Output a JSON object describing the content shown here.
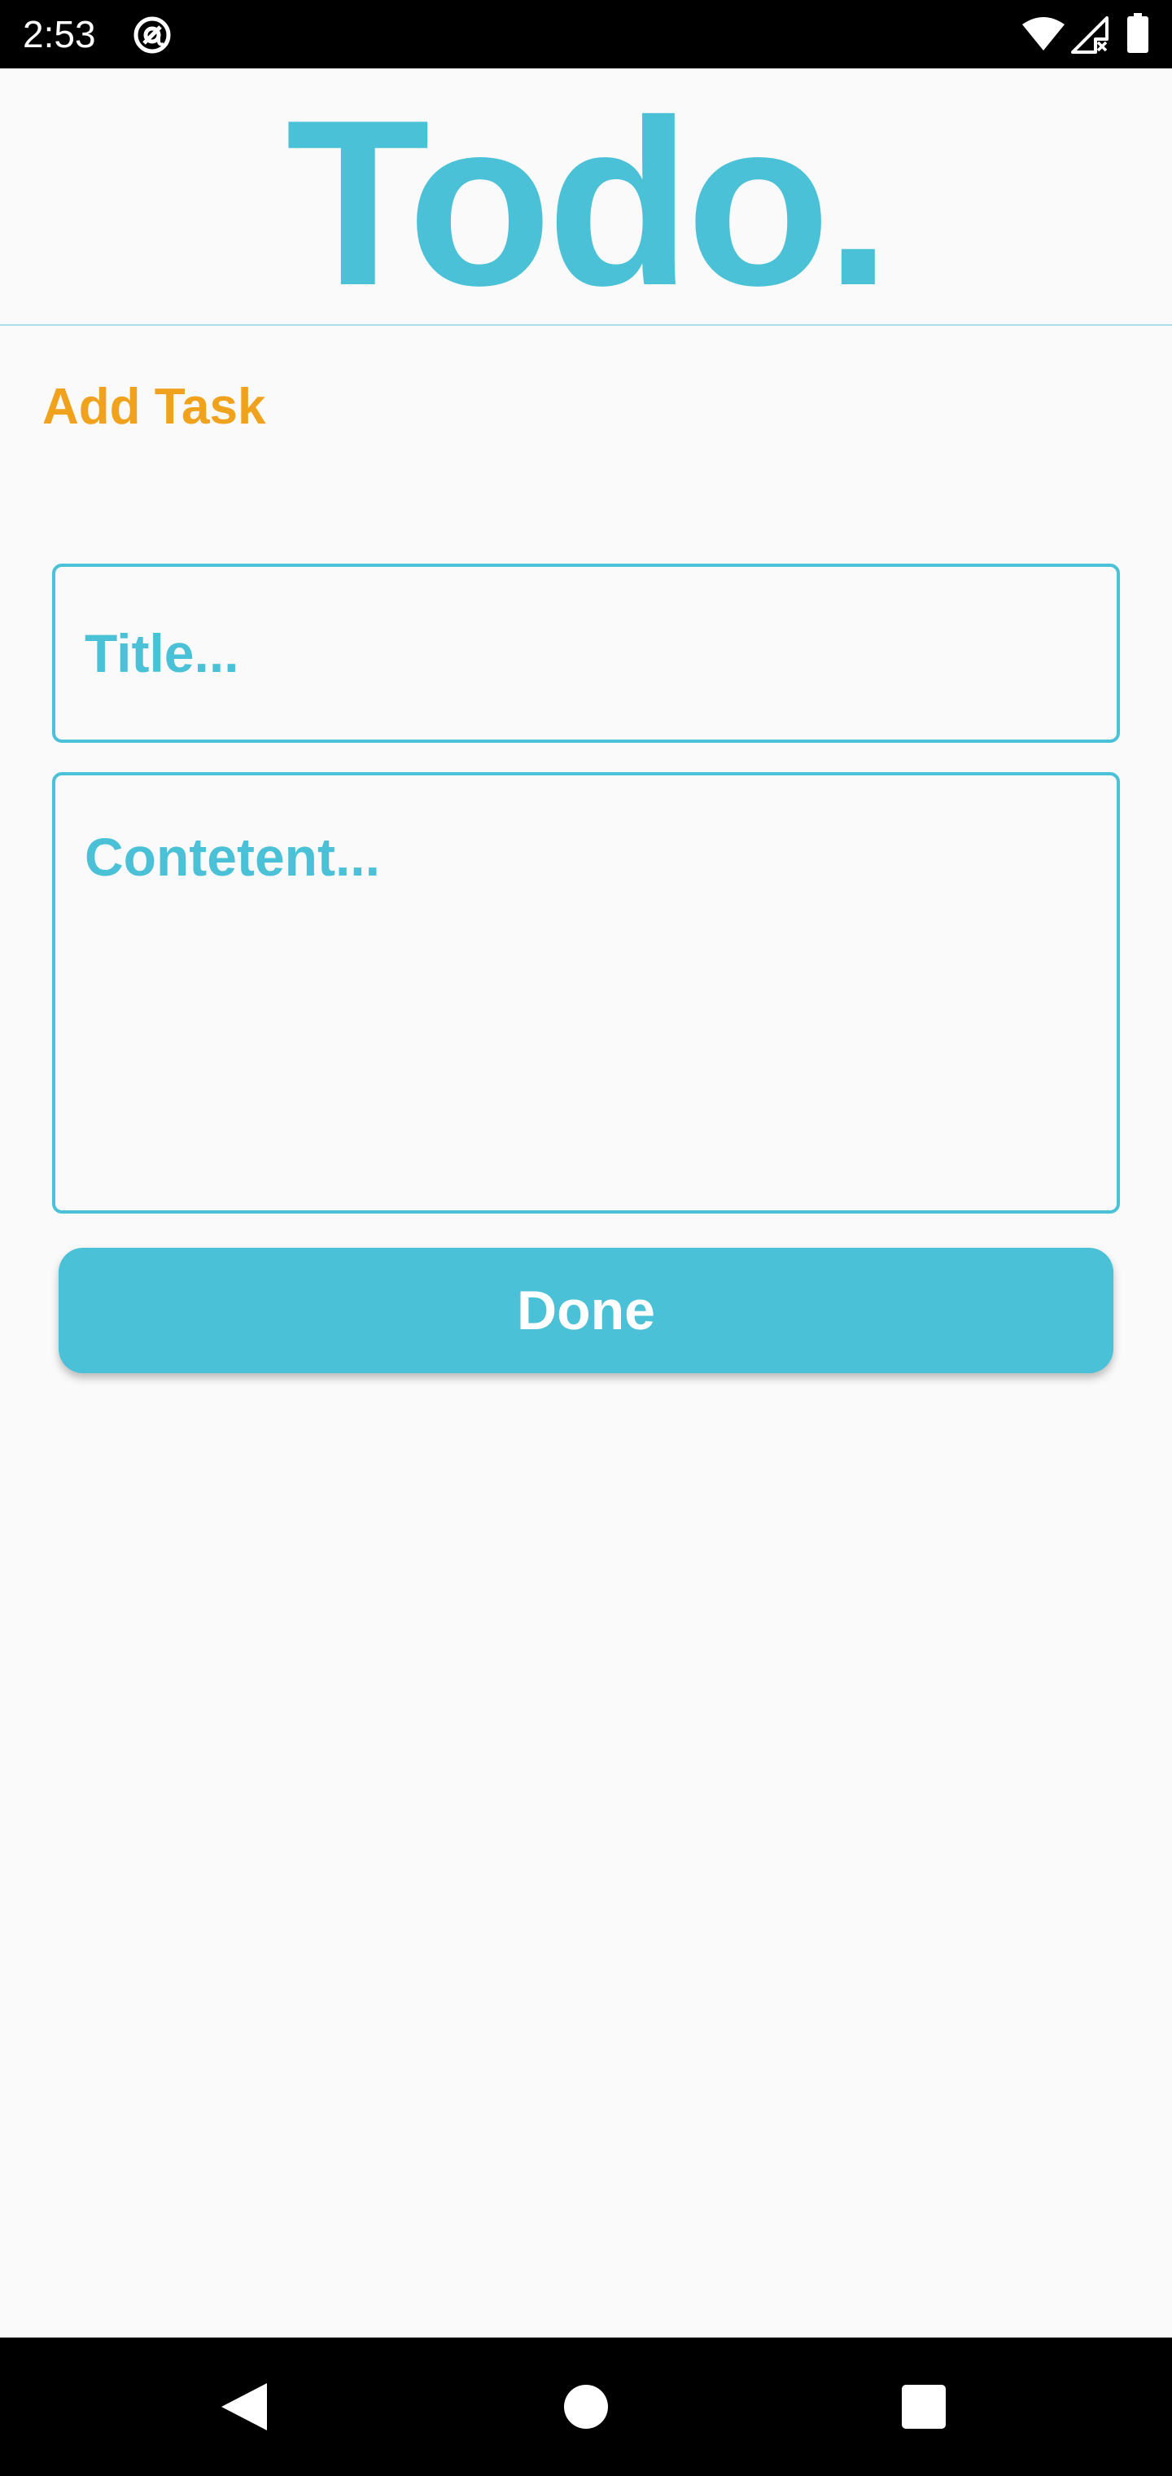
{
  "status_bar": {
    "time": "2:53",
    "app_icon": "at-sign-icon",
    "wifi_icon": "wifi-icon",
    "signal_icon": "cell-signal-no-service-icon",
    "battery_icon": "battery-icon"
  },
  "header": {
    "title": "Todo."
  },
  "section": {
    "heading": "Add Task"
  },
  "form": {
    "title_value": "",
    "title_placeholder": "Title...",
    "content_value": "",
    "content_placeholder": "Contetent...",
    "done_label": "Done"
  },
  "nav_bar": {
    "back_icon": "back-triangle-icon",
    "home_icon": "home-circle-icon",
    "recents_icon": "recents-square-icon"
  },
  "colors": {
    "accent": "#4bc1d8",
    "heading": "#f1a21c",
    "background": "#fafafa",
    "system_bar": "#000000"
  }
}
